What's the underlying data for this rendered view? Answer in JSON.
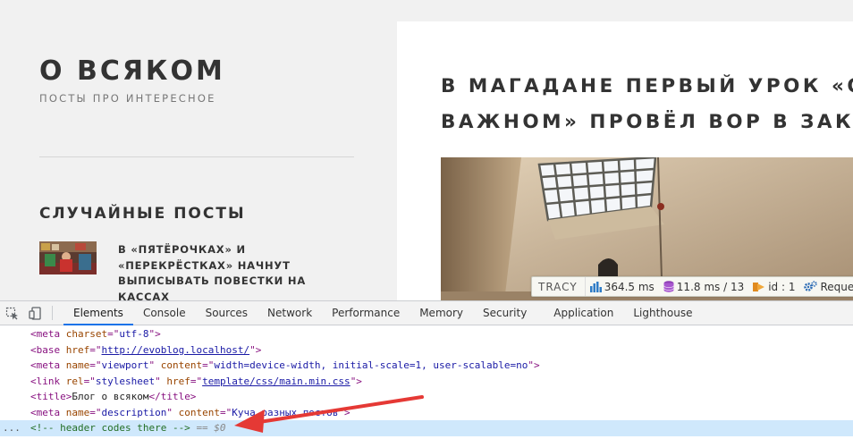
{
  "site": {
    "title": "О ВСЯКОМ",
    "tagline": "ПОСТЫ ПРО ИНТЕРЕСНОЕ"
  },
  "sidebar": {
    "widget_title": "СЛУЧАЙНЫЕ ПОСТЫ",
    "posts": [
      {
        "title": "В «ПЯТЁРОЧКАХ» И «ПЕРЕКРЁСТКАХ» НАЧНУТ ВЫПИСЫВАТЬ ПОВЕСТКИ НА КАССАХ"
      }
    ]
  },
  "article": {
    "title": "В МАГАДАНЕ ПЕРВЫЙ УРОК «О\nВАЖНОМ» ПРОВЁЛ ВОР В ЗАКОНЕ"
  },
  "tracy": {
    "logo": "TRACY",
    "time": "364.5 ms",
    "db": "11.8 ms / 13",
    "id": "id : 1",
    "request": "Request"
  },
  "devtools": {
    "tabs": [
      "Elements",
      "Console",
      "Sources",
      "Network",
      "Performance",
      "Memory",
      "Security",
      "Application",
      "Lighthouse"
    ],
    "active_tab": "Elements",
    "code": {
      "meta_charset": "utf-8",
      "base_href": "http://evoblog.localhost/",
      "viewport_content": "width=device-width, initial-scale=1, user-scalable=no",
      "stylesheet_rel": "stylesheet",
      "stylesheet_href": "template/css/main.min.css",
      "title_text": "Блог о всяком",
      "description_content": "Куча разных постов",
      "comment": "<!-- header codes there -->",
      "selected_marker": "== $0",
      "gutter": "..."
    }
  },
  "colors": {
    "accent": "#1a73e8",
    "arrow": "#e53935",
    "selection": "#cfe8fc"
  }
}
